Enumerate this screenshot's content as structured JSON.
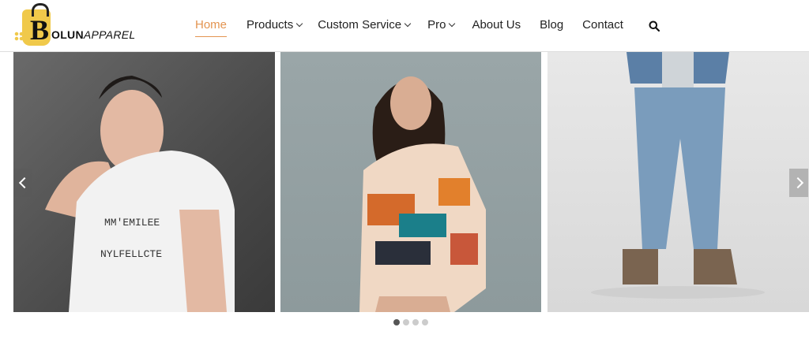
{
  "logo": {
    "letter": "B",
    "text_bold": "OLUN",
    "text_rest": "APPAREL"
  },
  "nav": {
    "items": [
      {
        "label": "Home",
        "active": true,
        "dropdown": false
      },
      {
        "label": "Products",
        "active": false,
        "dropdown": true
      },
      {
        "label": "Custom Service",
        "active": false,
        "dropdown": true
      },
      {
        "label": "Pro",
        "active": false,
        "dropdown": true
      },
      {
        "label": "About Us",
        "active": false,
        "dropdown": false
      },
      {
        "label": "Blog",
        "active": false,
        "dropdown": false
      },
      {
        "label": "Contact",
        "active": false,
        "dropdown": false
      }
    ],
    "search_icon": "search-icon",
    "active_color": "#e39450"
  },
  "slider": {
    "slides": [
      {
        "subject": "man in white printed t-shirt",
        "shirt_print": "MM'EMILEE / NYLFELLCTE"
      },
      {
        "subject": "woman in abstract print oversized hoodie"
      },
      {
        "subject": "model in denim jacket and ripped jeans with boots"
      }
    ],
    "dot_count": 4,
    "active_dot": 0,
    "prev_icon": "chevron-left-icon",
    "next_icon": "chevron-right-icon"
  }
}
